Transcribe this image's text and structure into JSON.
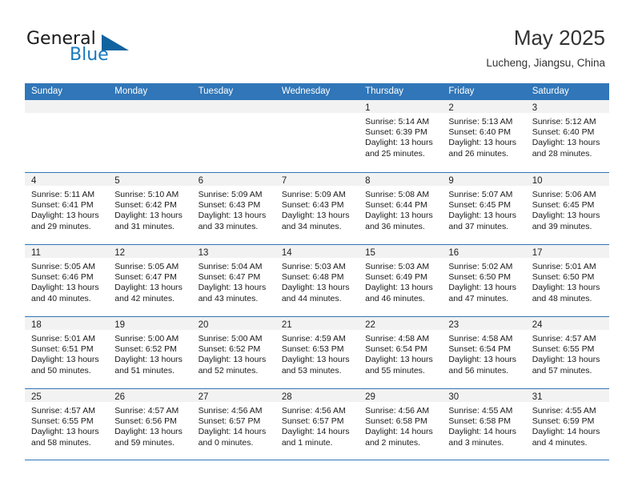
{
  "brand": {
    "name_part1": "General",
    "name_part2": "Blue",
    "accent_color": "#1878bd",
    "triangle_color": "#11639f"
  },
  "header": {
    "title": "May 2025",
    "subtitle": "Lucheng, Jiangsu, China"
  },
  "calendar": {
    "header_bg": "#3076b8",
    "daynum_bg": "#f2f2f2",
    "weekdays": [
      "Sunday",
      "Monday",
      "Tuesday",
      "Wednesday",
      "Thursday",
      "Friday",
      "Saturday"
    ],
    "weeks": [
      [
        {
          "day": "",
          "lines": []
        },
        {
          "day": "",
          "lines": []
        },
        {
          "day": "",
          "lines": []
        },
        {
          "day": "",
          "lines": []
        },
        {
          "day": "1",
          "lines": [
            "Sunrise: 5:14 AM",
            "Sunset: 6:39 PM",
            "Daylight: 13 hours",
            "and 25 minutes."
          ]
        },
        {
          "day": "2",
          "lines": [
            "Sunrise: 5:13 AM",
            "Sunset: 6:40 PM",
            "Daylight: 13 hours",
            "and 26 minutes."
          ]
        },
        {
          "day": "3",
          "lines": [
            "Sunrise: 5:12 AM",
            "Sunset: 6:40 PM",
            "Daylight: 13 hours",
            "and 28 minutes."
          ]
        }
      ],
      [
        {
          "day": "4",
          "lines": [
            "Sunrise: 5:11 AM",
            "Sunset: 6:41 PM",
            "Daylight: 13 hours",
            "and 29 minutes."
          ]
        },
        {
          "day": "5",
          "lines": [
            "Sunrise: 5:10 AM",
            "Sunset: 6:42 PM",
            "Daylight: 13 hours",
            "and 31 minutes."
          ]
        },
        {
          "day": "6",
          "lines": [
            "Sunrise: 5:09 AM",
            "Sunset: 6:43 PM",
            "Daylight: 13 hours",
            "and 33 minutes."
          ]
        },
        {
          "day": "7",
          "lines": [
            "Sunrise: 5:09 AM",
            "Sunset: 6:43 PM",
            "Daylight: 13 hours",
            "and 34 minutes."
          ]
        },
        {
          "day": "8",
          "lines": [
            "Sunrise: 5:08 AM",
            "Sunset: 6:44 PM",
            "Daylight: 13 hours",
            "and 36 minutes."
          ]
        },
        {
          "day": "9",
          "lines": [
            "Sunrise: 5:07 AM",
            "Sunset: 6:45 PM",
            "Daylight: 13 hours",
            "and 37 minutes."
          ]
        },
        {
          "day": "10",
          "lines": [
            "Sunrise: 5:06 AM",
            "Sunset: 6:45 PM",
            "Daylight: 13 hours",
            "and 39 minutes."
          ]
        }
      ],
      [
        {
          "day": "11",
          "lines": [
            "Sunrise: 5:05 AM",
            "Sunset: 6:46 PM",
            "Daylight: 13 hours",
            "and 40 minutes."
          ]
        },
        {
          "day": "12",
          "lines": [
            "Sunrise: 5:05 AM",
            "Sunset: 6:47 PM",
            "Daylight: 13 hours",
            "and 42 minutes."
          ]
        },
        {
          "day": "13",
          "lines": [
            "Sunrise: 5:04 AM",
            "Sunset: 6:47 PM",
            "Daylight: 13 hours",
            "and 43 minutes."
          ]
        },
        {
          "day": "14",
          "lines": [
            "Sunrise: 5:03 AM",
            "Sunset: 6:48 PM",
            "Daylight: 13 hours",
            "and 44 minutes."
          ]
        },
        {
          "day": "15",
          "lines": [
            "Sunrise: 5:03 AM",
            "Sunset: 6:49 PM",
            "Daylight: 13 hours",
            "and 46 minutes."
          ]
        },
        {
          "day": "16",
          "lines": [
            "Sunrise: 5:02 AM",
            "Sunset: 6:50 PM",
            "Daylight: 13 hours",
            "and 47 minutes."
          ]
        },
        {
          "day": "17",
          "lines": [
            "Sunrise: 5:01 AM",
            "Sunset: 6:50 PM",
            "Daylight: 13 hours",
            "and 48 minutes."
          ]
        }
      ],
      [
        {
          "day": "18",
          "lines": [
            "Sunrise: 5:01 AM",
            "Sunset: 6:51 PM",
            "Daylight: 13 hours",
            "and 50 minutes."
          ]
        },
        {
          "day": "19",
          "lines": [
            "Sunrise: 5:00 AM",
            "Sunset: 6:52 PM",
            "Daylight: 13 hours",
            "and 51 minutes."
          ]
        },
        {
          "day": "20",
          "lines": [
            "Sunrise: 5:00 AM",
            "Sunset: 6:52 PM",
            "Daylight: 13 hours",
            "and 52 minutes."
          ]
        },
        {
          "day": "21",
          "lines": [
            "Sunrise: 4:59 AM",
            "Sunset: 6:53 PM",
            "Daylight: 13 hours",
            "and 53 minutes."
          ]
        },
        {
          "day": "22",
          "lines": [
            "Sunrise: 4:58 AM",
            "Sunset: 6:54 PM",
            "Daylight: 13 hours",
            "and 55 minutes."
          ]
        },
        {
          "day": "23",
          "lines": [
            "Sunrise: 4:58 AM",
            "Sunset: 6:54 PM",
            "Daylight: 13 hours",
            "and 56 minutes."
          ]
        },
        {
          "day": "24",
          "lines": [
            "Sunrise: 4:57 AM",
            "Sunset: 6:55 PM",
            "Daylight: 13 hours",
            "and 57 minutes."
          ]
        }
      ],
      [
        {
          "day": "25",
          "lines": [
            "Sunrise: 4:57 AM",
            "Sunset: 6:55 PM",
            "Daylight: 13 hours",
            "and 58 minutes."
          ]
        },
        {
          "day": "26",
          "lines": [
            "Sunrise: 4:57 AM",
            "Sunset: 6:56 PM",
            "Daylight: 13 hours",
            "and 59 minutes."
          ]
        },
        {
          "day": "27",
          "lines": [
            "Sunrise: 4:56 AM",
            "Sunset: 6:57 PM",
            "Daylight: 14 hours",
            "and 0 minutes."
          ]
        },
        {
          "day": "28",
          "lines": [
            "Sunrise: 4:56 AM",
            "Sunset: 6:57 PM",
            "Daylight: 14 hours",
            "and 1 minute."
          ]
        },
        {
          "day": "29",
          "lines": [
            "Sunrise: 4:56 AM",
            "Sunset: 6:58 PM",
            "Daylight: 14 hours",
            "and 2 minutes."
          ]
        },
        {
          "day": "30",
          "lines": [
            "Sunrise: 4:55 AM",
            "Sunset: 6:58 PM",
            "Daylight: 14 hours",
            "and 3 minutes."
          ]
        },
        {
          "day": "31",
          "lines": [
            "Sunrise: 4:55 AM",
            "Sunset: 6:59 PM",
            "Daylight: 14 hours",
            "and 4 minutes."
          ]
        }
      ]
    ]
  }
}
